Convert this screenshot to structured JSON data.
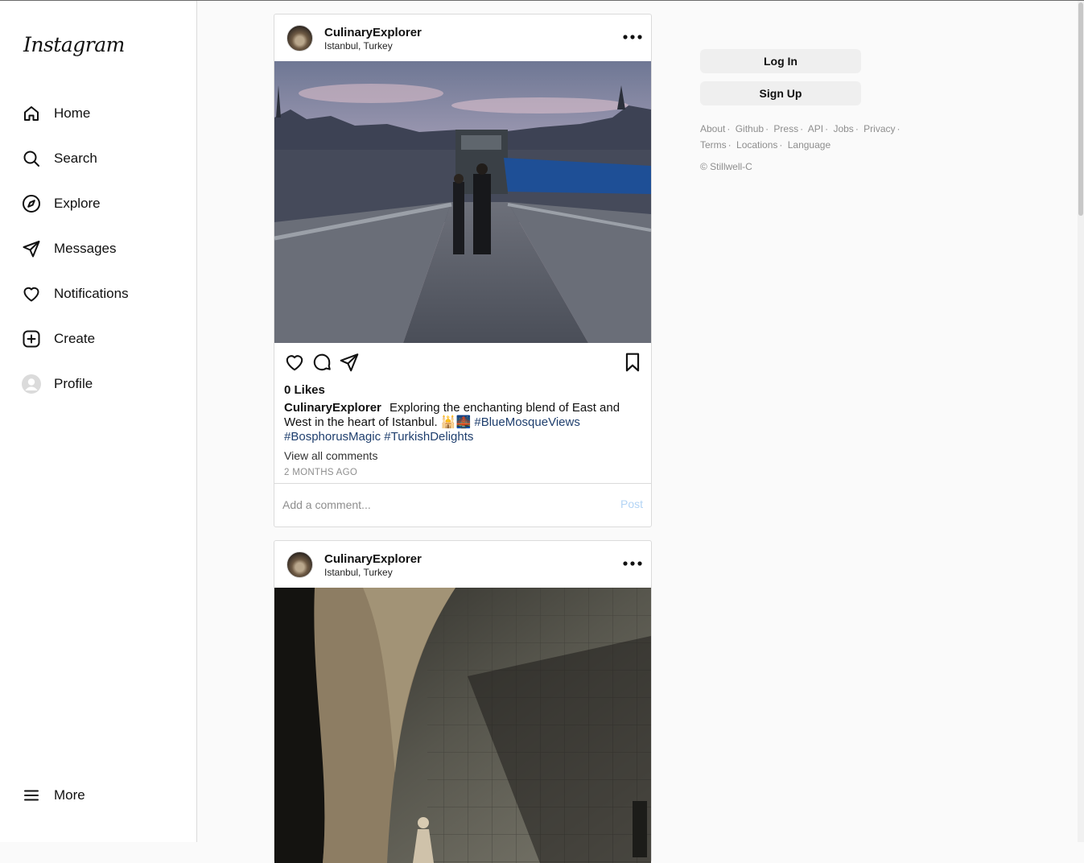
{
  "app": {
    "logo_text": "Instagram"
  },
  "sidebar": {
    "items": [
      {
        "label": "Home",
        "icon": "home-icon"
      },
      {
        "label": "Search",
        "icon": "search-icon"
      },
      {
        "label": "Explore",
        "icon": "compass-icon"
      },
      {
        "label": "Messages",
        "icon": "send-icon"
      },
      {
        "label": "Notifications",
        "icon": "heart-icon"
      },
      {
        "label": "Create",
        "icon": "plus-square-icon"
      },
      {
        "label": "Profile",
        "icon": "avatar-icon"
      }
    ],
    "more": {
      "label": "More",
      "icon": "menu-icon"
    }
  },
  "posts": [
    {
      "username": "CulinaryExplorer",
      "location": "Istanbul, Turkey",
      "likes": "0 Likes",
      "caption_user": "CulinaryExplorer",
      "caption_text": "Exploring the enchanting blend of East and West in the heart of Istanbul. 🕌🌉",
      "hashtags": [
        "#BlueMosqueViews",
        "#BosphorusMagic",
        "#TurkishDelights"
      ],
      "view_all": "View all comments",
      "time_ago": "2 MONTHS AGO",
      "comment_placeholder": "Add a comment...",
      "post_label": "Post"
    },
    {
      "username": "CulinaryExplorer",
      "location": "Istanbul, Turkey"
    }
  ],
  "right": {
    "login_label": "Log In",
    "signup_label": "Sign Up",
    "footer_links": [
      "About",
      "Github",
      "Press",
      "API",
      "Jobs",
      "Privacy",
      "Terms",
      "Locations",
      "Language"
    ],
    "copyright": "© Stillwell-C"
  },
  "colors": {
    "link_blue": "#1f3f6e",
    "post_button_disabled": "#b3d4f5",
    "button_bg": "#efefef"
  }
}
